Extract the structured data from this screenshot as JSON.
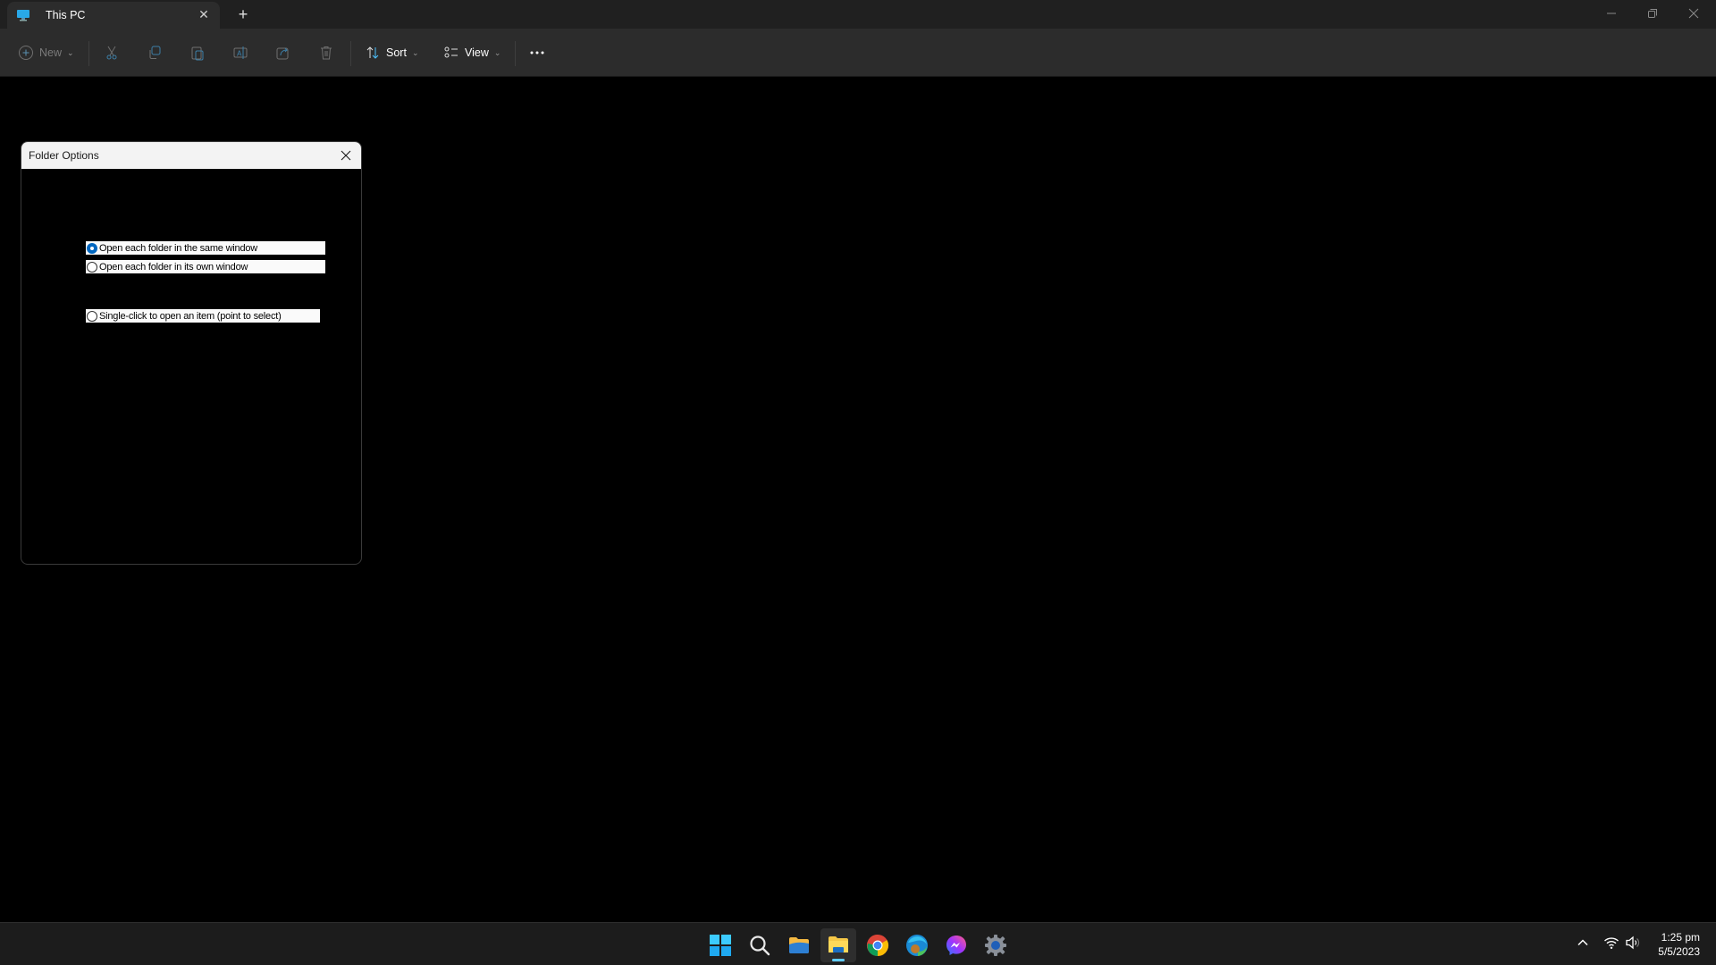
{
  "window": {
    "tab_title": "This PC",
    "tab_icon": "monitor-icon",
    "new_tab_icon": "plus-icon",
    "controls": [
      "minimize-icon",
      "restore-icon",
      "close-icon"
    ]
  },
  "toolbar": {
    "new_label": "New",
    "sort_label": "Sort",
    "view_label": "View",
    "buttons": [
      {
        "name": "cut",
        "icon": "scissors-icon",
        "enabled": false
      },
      {
        "name": "copy",
        "icon": "copy-icon",
        "enabled": false
      },
      {
        "name": "paste",
        "icon": "paste-icon",
        "enabled": false
      },
      {
        "name": "rename",
        "icon": "rename-icon",
        "enabled": false
      },
      {
        "name": "share",
        "icon": "share-icon",
        "enabled": false
      },
      {
        "name": "delete",
        "icon": "trash-icon",
        "enabled": false
      }
    ],
    "more_icon": "ellipsis-icon"
  },
  "dialog": {
    "title": "Folder Options",
    "options": [
      {
        "label": "Open each folder in the same window",
        "checked": true
      },
      {
        "label": "Open each folder in its own window",
        "checked": false
      },
      {
        "label": "Single-click to open an item (point to select)",
        "checked": false
      }
    ]
  },
  "taskbar": {
    "apps": [
      {
        "name": "start",
        "icon": "windows-logo-icon"
      },
      {
        "name": "search",
        "icon": "search-icon"
      },
      {
        "name": "file-explorer",
        "icon": "folder-icon"
      },
      {
        "name": "file-explorer-active",
        "icon": "file-explorer-icon",
        "active": true
      },
      {
        "name": "chrome",
        "icon": "chrome-icon"
      },
      {
        "name": "edge",
        "icon": "edge-icon"
      },
      {
        "name": "messenger",
        "icon": "messenger-icon"
      },
      {
        "name": "settings",
        "icon": "settings-gear-icon"
      }
    ],
    "time": "1:25 pm",
    "date": "5/5/2023"
  },
  "colors": {
    "accent": "#0067c0",
    "indicator": "#60cdff"
  }
}
